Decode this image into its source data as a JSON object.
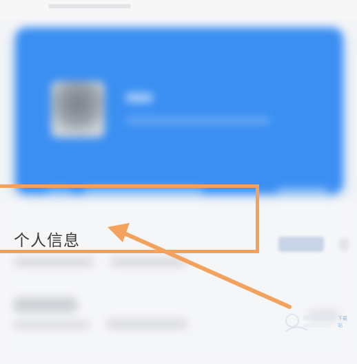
{
  "section": {
    "title": "个人信息"
  },
  "watermark": {
    "site": "下载站"
  },
  "colors": {
    "card_blue": "#3b8ff2",
    "annotation_orange": "#f3a25e",
    "background": "#f4f5f7"
  }
}
